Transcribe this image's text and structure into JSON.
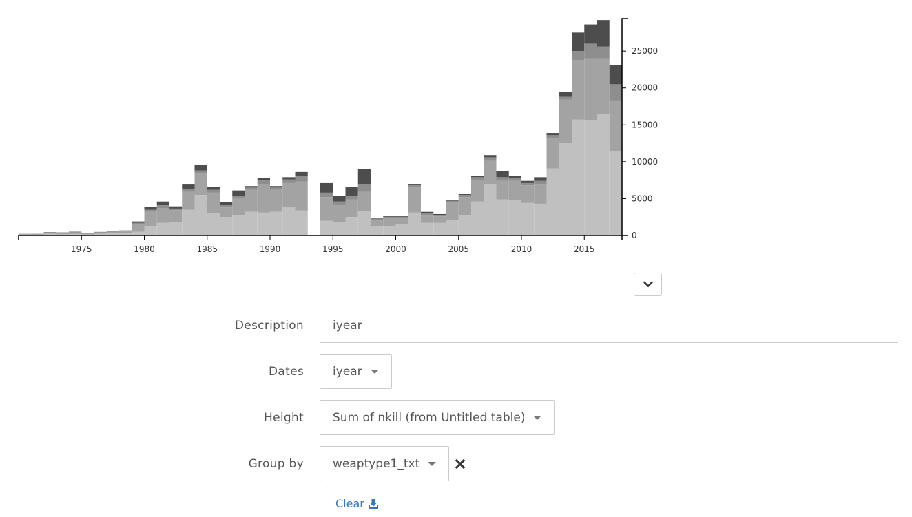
{
  "chart_data": {
    "type": "bar",
    "stacked": true,
    "x": [
      1970,
      1971,
      1972,
      1973,
      1974,
      1975,
      1976,
      1977,
      1978,
      1979,
      1980,
      1981,
      1982,
      1983,
      1984,
      1985,
      1986,
      1987,
      1988,
      1989,
      1990,
      1991,
      1992,
      1993,
      1994,
      1995,
      1996,
      1997,
      1998,
      1999,
      2000,
      2001,
      2002,
      2003,
      2004,
      2005,
      2006,
      2007,
      2008,
      2009,
      2010,
      2011,
      2012,
      2013,
      2014,
      2015,
      2016,
      2017
    ],
    "series": [
      {
        "color": "#c0c0c0",
        "values": [
          80,
          90,
          230,
          150,
          200,
          120,
          210,
          250,
          300,
          500,
          1300,
          1700,
          1750,
          3500,
          5500,
          3000,
          2500,
          2700,
          3200,
          3100,
          3200,
          3800,
          3400,
          0,
          2000,
          1800,
          2500,
          3300,
          1300,
          1200,
          1500,
          3100,
          1700,
          1700,
          2100,
          2800,
          4600,
          7000,
          4900,
          4800,
          4400,
          4300,
          9100,
          12600,
          15700,
          15600,
          16500,
          11400
        ]
      },
      {
        "color": "#a3a3a3",
        "values": [
          90,
          90,
          150,
          180,
          220,
          120,
          180,
          230,
          250,
          1000,
          1900,
          2000,
          1700,
          2400,
          2900,
          2800,
          1300,
          2300,
          3000,
          3900,
          3000,
          3300,
          3900,
          0,
          3200,
          2300,
          2400,
          2600,
          800,
          1100,
          800,
          3500,
          1000,
          900,
          2400,
          2400,
          2900,
          3100,
          2500,
          2600,
          2400,
          2600,
          4100,
          5800,
          8100,
          8400,
          7500,
          6900
        ]
      },
      {
        "color": "#8e8e8e",
        "values": [
          20,
          20,
          40,
          50,
          50,
          30,
          50,
          60,
          70,
          200,
          300,
          400,
          200,
          400,
          400,
          400,
          300,
          400,
          300,
          500,
          300,
          500,
          800,
          0,
          600,
          500,
          500,
          1100,
          200,
          200,
          200,
          200,
          300,
          200,
          200,
          300,
          400,
          500,
          500,
          400,
          300,
          500,
          400,
          400,
          1200,
          2000,
          1600,
          2200
        ]
      },
      {
        "color": "#4d4d4d",
        "values": [
          20,
          20,
          30,
          30,
          40,
          20,
          40,
          40,
          60,
          200,
          400,
          500,
          300,
          600,
          800,
          400,
          400,
          700,
          200,
          300,
          200,
          300,
          500,
          0,
          1300,
          800,
          1200,
          2000,
          100,
          100,
          100,
          100,
          200,
          100,
          100,
          100,
          200,
          300,
          800,
          300,
          300,
          500,
          300,
          700,
          2500,
          2600,
          3600,
          2600
        ]
      }
    ],
    "x_ticks": [
      "1975",
      "1980",
      "1985",
      "1990",
      "1995",
      "2000",
      "2005",
      "2010",
      "2015"
    ],
    "y_ticks": [
      "0",
      "5000",
      "10000",
      "15000",
      "20000",
      "25000"
    ],
    "xlim": [
      1970,
      2018
    ],
    "ylim": [
      0,
      29400
    ]
  },
  "form": {
    "description_label": "Description",
    "description_value": "iyear",
    "dates_label": "Dates",
    "dates_value": "iyear",
    "height_label": "Height",
    "height_value": "Sum of nkill (from Untitled table)",
    "groupby_label": "Group by",
    "groupby_value": "weaptype1_txt",
    "clear_label": "Clear"
  },
  "icons": {
    "collapse": "chevron-down-icon",
    "remove": "close-icon",
    "clear": "download-icon"
  },
  "colors": {
    "link": "#337ab7",
    "border": "#cccccc"
  }
}
